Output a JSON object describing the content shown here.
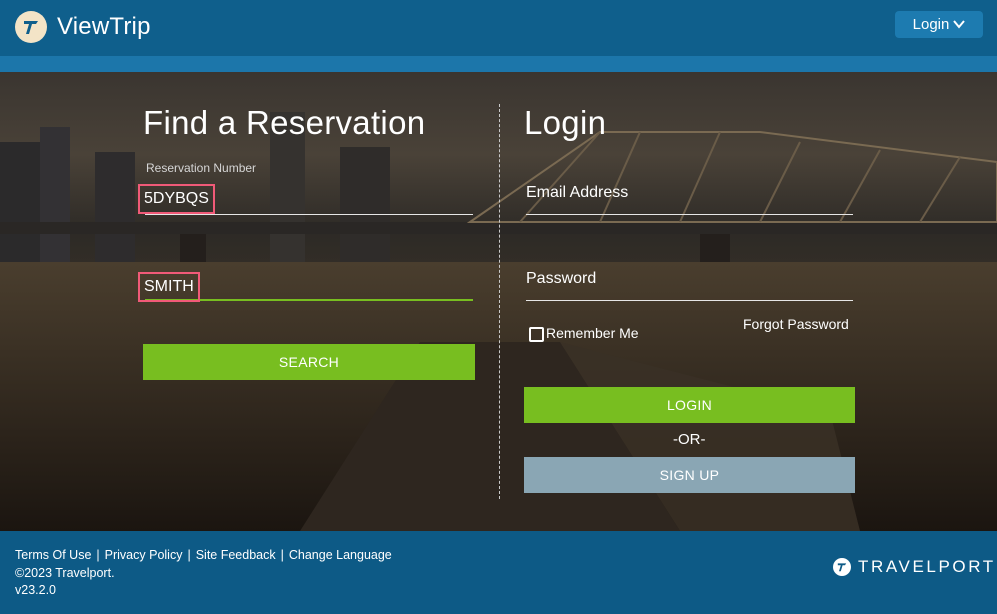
{
  "header": {
    "brand": "ViewTrip",
    "login_menu_label": "Login"
  },
  "find": {
    "title": "Find a Reservation",
    "reservation_label": "Reservation Number",
    "reservation_value": "5DYBQS",
    "last_name_value": "SMITH",
    "search_label": "SEARCH"
  },
  "login": {
    "title": "Login",
    "email_label": "Email Address",
    "password_label": "Password",
    "remember_label": "Remember Me",
    "forgot_label": "Forgot Password",
    "login_label": "LOGIN",
    "or_label": "-OR-",
    "signup_label": "SIGN UP"
  },
  "footer": {
    "links": [
      "Terms Of Use",
      "Privacy Policy",
      "Site Feedback",
      "Change Language"
    ],
    "copyright": "©2023 Travelport.",
    "version": "v23.2.0",
    "brand": "TRAVELPORT"
  },
  "colors": {
    "header_bg": "#0f5f8c",
    "accent_green": "#78be20",
    "signup_grey": "#8aa6b4",
    "highlight_pink": "#f05a78"
  }
}
